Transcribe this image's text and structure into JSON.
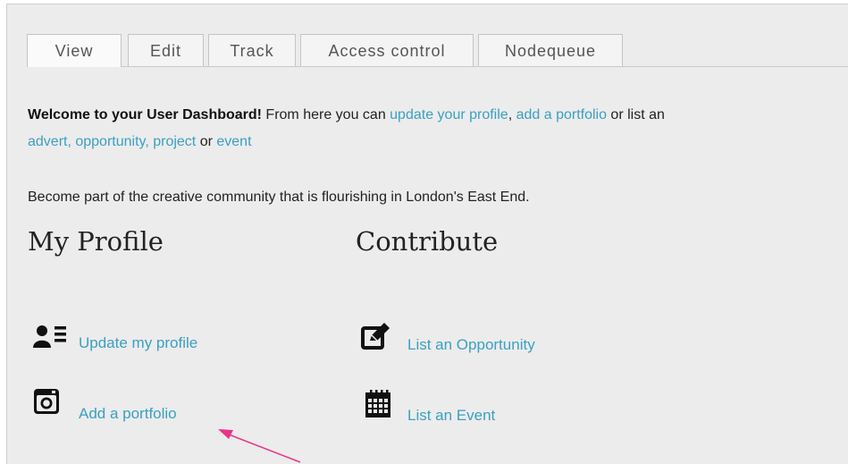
{
  "tabs": [
    "View",
    "Edit",
    "Track",
    "Access control",
    "Nodequeue"
  ],
  "welcome": {
    "bold": "Welcome to your User Dashboard!",
    "t1": " From here you can ",
    "link_profile": "update your profile",
    "t2": ", ",
    "link_portfolio": "add a portfolio",
    "t3": " or list an ",
    "link_advert": "advert, opportunity, project",
    "t4": " or ",
    "link_event": "event"
  },
  "community_text": "Become part of the creative community that is flourishing in London's East End.",
  "my_profile": {
    "heading": "My Profile",
    "update_label": "Update my profile",
    "portfolio_label": "Add a portfolio"
  },
  "contribute": {
    "heading": "Contribute",
    "opportunity_label": "List an Opportunity",
    "event_label": "List an Event"
  },
  "icons": {
    "update": "user-list-icon",
    "portfolio": "instagram-icon",
    "opportunity": "edit-icon",
    "event": "calendar-icon"
  },
  "colors": {
    "link": "#3aa0c2",
    "annotation_arrow": "#e8358a",
    "background": "#ececec"
  }
}
